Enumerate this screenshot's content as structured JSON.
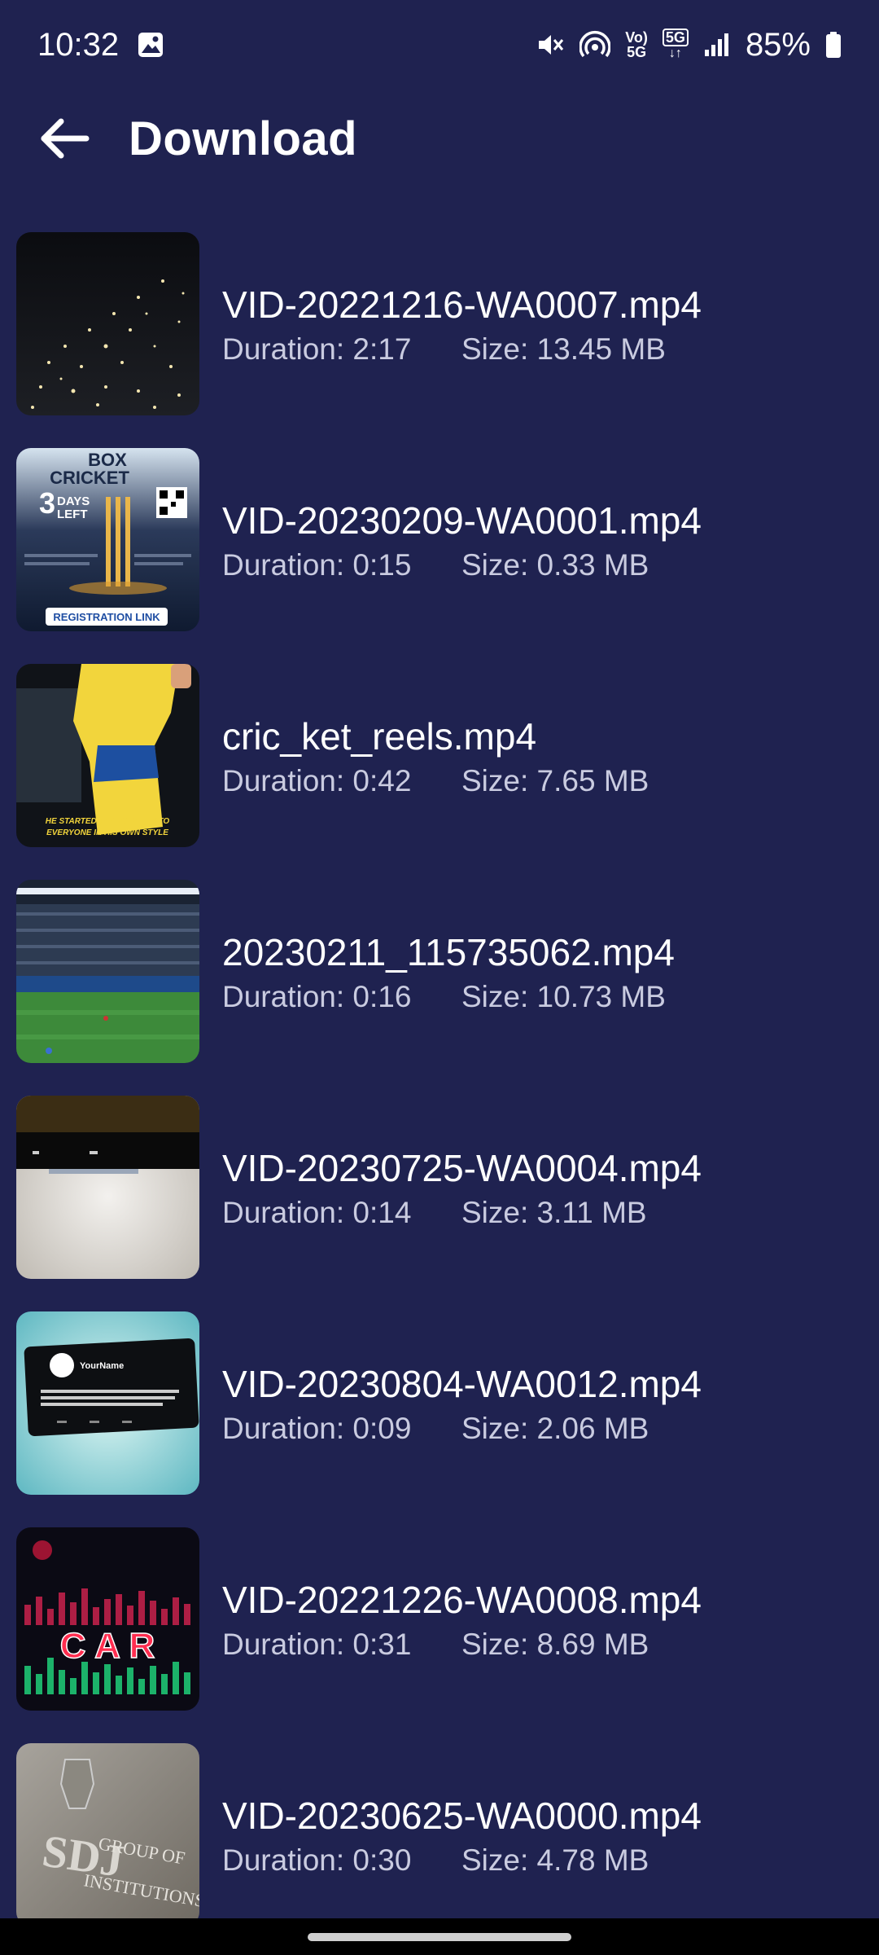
{
  "status_bar": {
    "time": "10:32",
    "volte_top": "Vo)",
    "volte_bottom": "5G",
    "network": "5G",
    "battery": "85%",
    "icons": [
      "gallery-icon",
      "mute-icon",
      "hotspot-icon",
      "volte-icon",
      "5g-icon",
      "signal-icon",
      "battery-icon"
    ]
  },
  "app_bar": {
    "title": "Download",
    "back_icon": "arrow-left-icon"
  },
  "videos": [
    {
      "name": "VID-20221216-WA0007.mp4",
      "duration": "Duration: 2:17",
      "size": "Size: 13.45 MB"
    },
    {
      "name": "VID-20230209-WA0001.mp4",
      "duration": "Duration: 0:15",
      "size": "Size: 0.33 MB"
    },
    {
      "name": "cric_ket_reels.mp4",
      "duration": "Duration: 0:42",
      "size": "Size: 7.65 MB"
    },
    {
      "name": "20230211_115735062.mp4",
      "duration": "Duration: 0:16",
      "size": "Size: 10.73 MB"
    },
    {
      "name": "VID-20230725-WA0004.mp4",
      "duration": "Duration: 0:14",
      "size": "Size: 3.11 MB"
    },
    {
      "name": "VID-20230804-WA0012.mp4",
      "duration": "Duration: 0:09",
      "size": "Size: 2.06 MB"
    },
    {
      "name": "VID-20221226-WA0008.mp4",
      "duration": "Duration: 0:31",
      "size": "Size: 8.69 MB"
    },
    {
      "name": "VID-20230625-WA0000.mp4",
      "duration": "Duration: 0:30",
      "size": "Size: 4.78 MB"
    }
  ],
  "thumb_text": {
    "box": "BOX",
    "cricket": "CRICKET",
    "days_num": "3",
    "days": "DAYS",
    "left": "LEFT",
    "registration": "REGISTRATION LINK",
    "reel_line1": "HE STARTED GIVING REPLY TO",
    "reel_line2": "EVERYONE IN HIS OWN STYLE",
    "your_name": "YourName",
    "car": "C A R",
    "sdj1": "GROUP OF",
    "sdj2": "INSTITUTIONS",
    "sdj_logo": "SDJ"
  },
  "colors": {
    "background": "#1f2250",
    "text_primary": "#ffffff",
    "text_secondary": "#c9cbe0"
  }
}
